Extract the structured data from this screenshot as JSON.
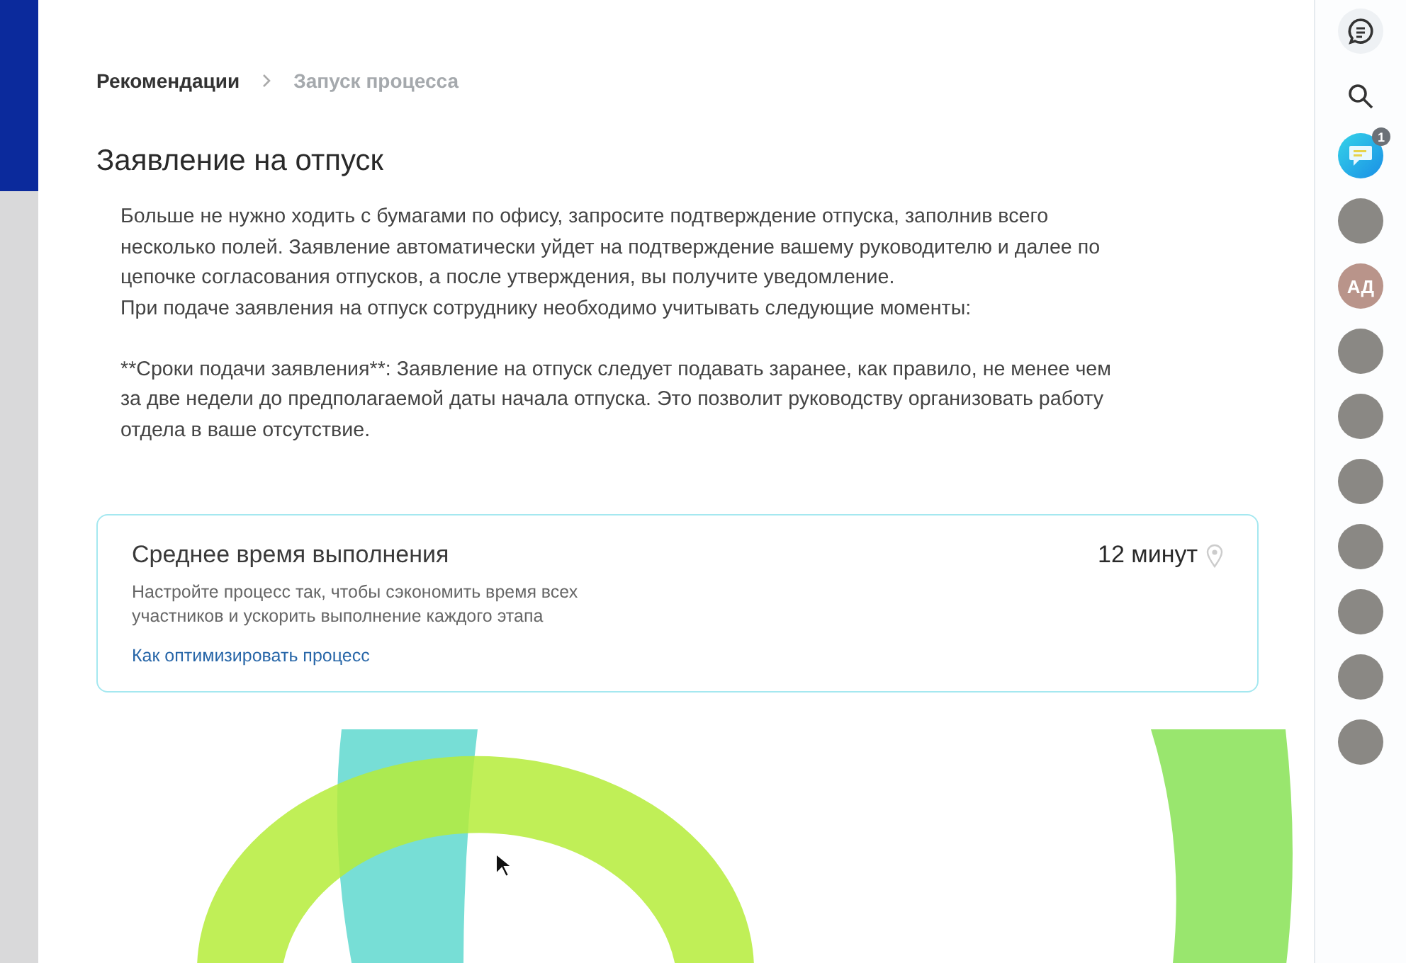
{
  "breadcrumbs": [
    {
      "label": "Рекомендации",
      "selected": false
    },
    {
      "label": "Запуск процесса",
      "selected": true
    }
  ],
  "title": "Заявление на отпуск",
  "description": [
    [
      "Больше не нужно ходить с бумагами по офису, запросите подтверждение отпуска, заполнив всего несколько полей. Заявление автоматически уйдет на подтверждение вашему руководителю и далее по цепочке согласования отпусков, а после утверждения, вы получите уведомление.",
      "При подаче заявления на отпуск сотруднику необходимо учитывать следующие моменты:"
    ],
    [
      "**Сроки подачи заявления**: Заявление на отпуск следует подавать заранее, как правило, не менее чем за две недели до предполагаемой даты начала отпуска. Это позволит руководству организовать работу отдела в ваше отсутствие."
    ]
  ],
  "stat_card": {
    "title": "Среднее время выполнения",
    "value": "12 минут",
    "hint": "Настройте процесс так, чтобы сэкономить время всех участников и ускорить выполнение каждого этапа",
    "link": "Как оптимизировать процесс"
  },
  "right_bar": {
    "contacts": [
      {
        "kind": "chat",
        "badge": "1"
      },
      {
        "kind": "photo"
      },
      {
        "kind": "initials",
        "initials": "АД"
      },
      {
        "kind": "photo"
      },
      {
        "kind": "photo"
      },
      {
        "kind": "photo"
      },
      {
        "kind": "photo"
      },
      {
        "kind": "photo"
      },
      {
        "kind": "photo"
      },
      {
        "kind": "photo"
      }
    ]
  }
}
